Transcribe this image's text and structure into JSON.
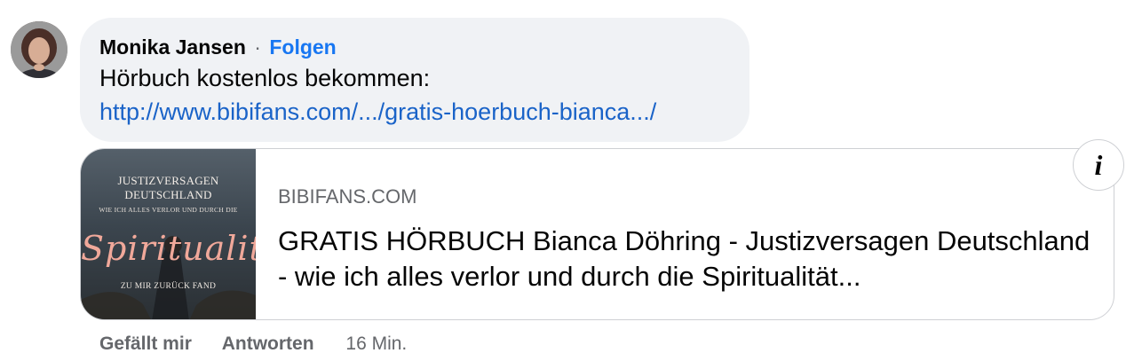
{
  "comment": {
    "author": "Monika Jansen",
    "separator": "·",
    "follow_label": "Folgen",
    "text": "Hörbuch kostenlos bekommen:",
    "link_text": "http://www.bibifans.com/.../gratis-hoerbuch-bianca.../"
  },
  "link_preview": {
    "thumbnail": {
      "line1": "JUSTIZVERSAGEN DEUTSCHLAND",
      "line2": "WIE ICH ALLES VERLOR UND DURCH DIE",
      "line3": "Spiritualität",
      "line4": "ZU MIR ZURÜCK FAND"
    },
    "domain": "BIBIFANS.COM",
    "title": "GRATIS HÖRBUCH Bianca Döhring - Justizversagen Deutschland - wie ich alles verlor und durch die Spiritualität..."
  },
  "info_icon": "info-icon",
  "actions": {
    "like_label": "Gefällt mir",
    "reply_label": "Antworten",
    "timestamp": "16 Min."
  },
  "colors": {
    "bubble_bg": "#f0f2f5",
    "link": "#1a63c8",
    "follow": "#1877f2",
    "muted": "#65676b"
  }
}
